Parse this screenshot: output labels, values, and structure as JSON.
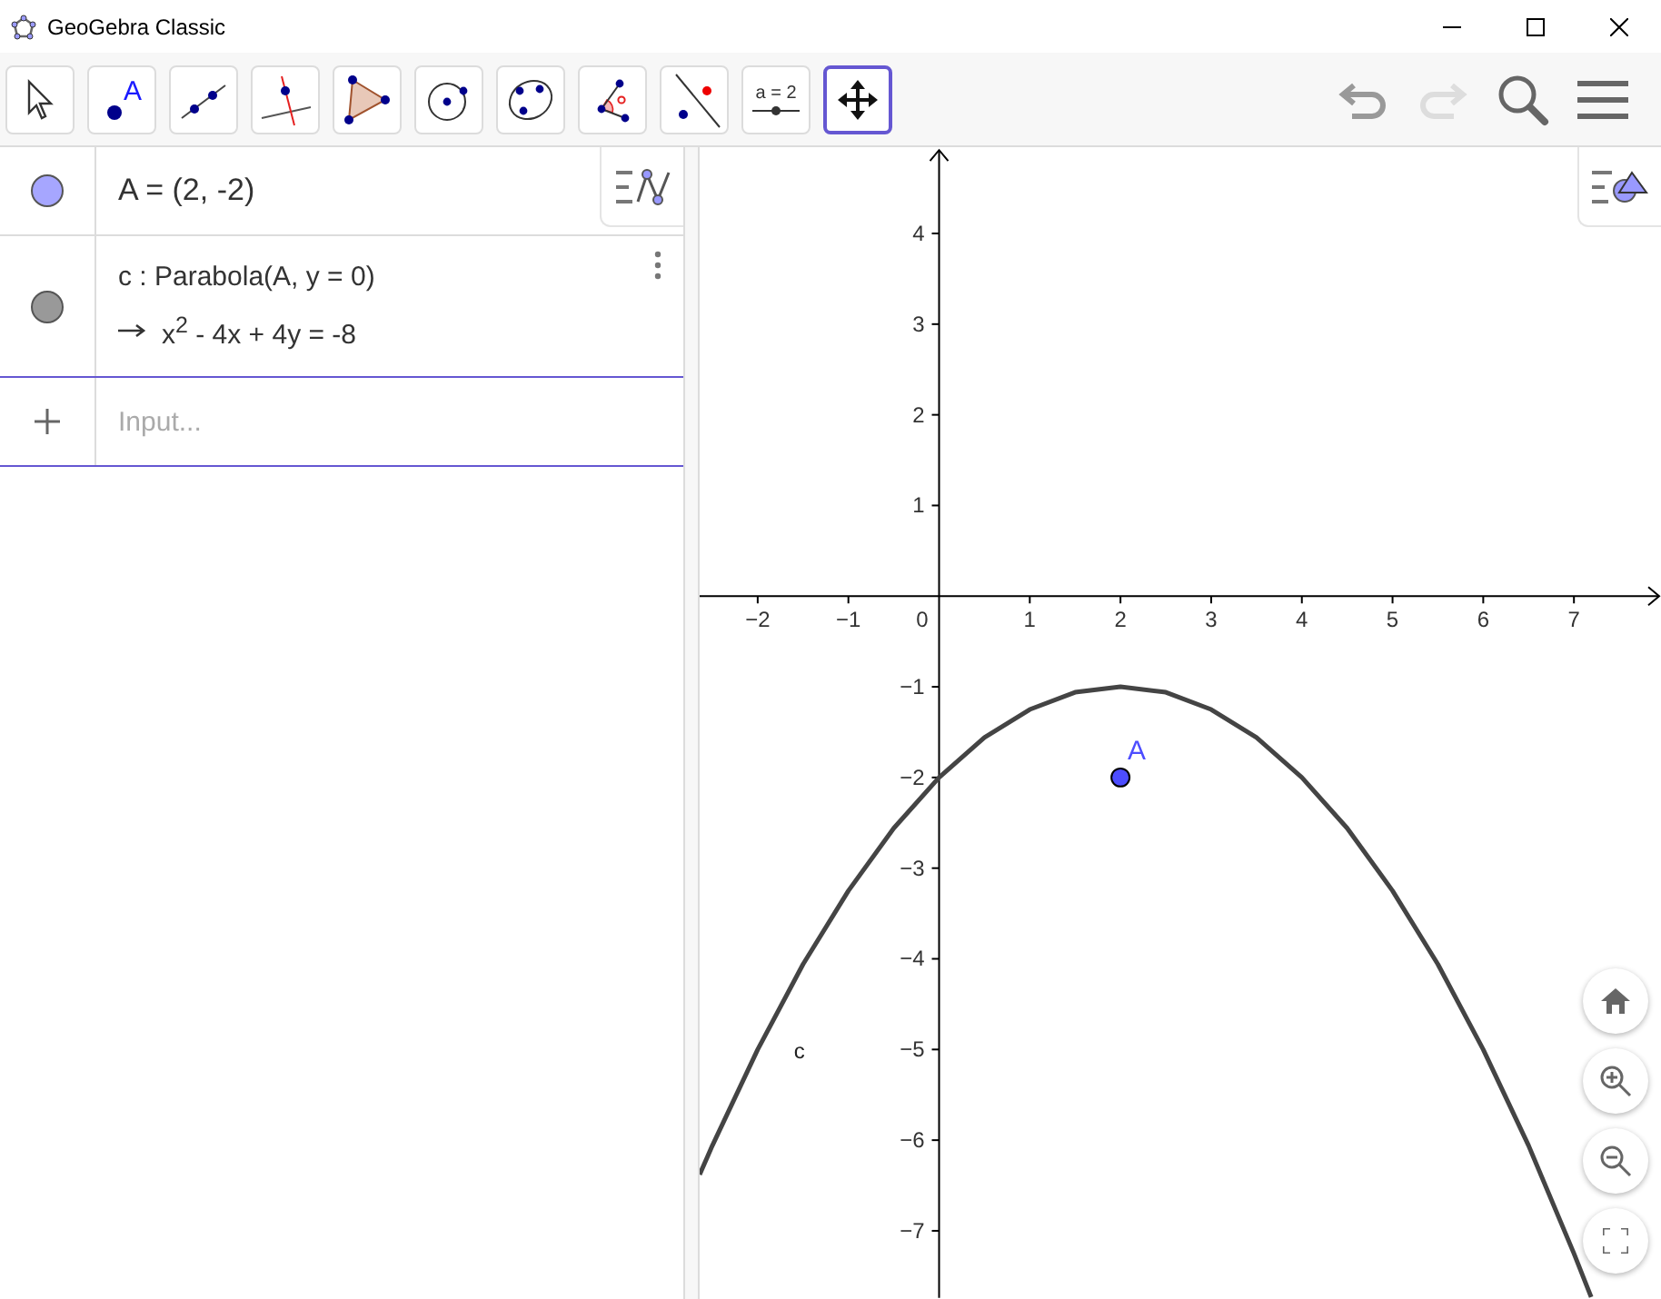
{
  "window": {
    "title": "GeoGebra Classic"
  },
  "toolbar": {
    "tools": [
      {
        "kind": "move",
        "selected": false
      },
      {
        "kind": "point",
        "selected": false,
        "label": "A"
      },
      {
        "kind": "line",
        "selected": false
      },
      {
        "kind": "perpendicular",
        "selected": false
      },
      {
        "kind": "polygon",
        "selected": false
      },
      {
        "kind": "circle",
        "selected": false
      },
      {
        "kind": "ellipse",
        "selected": false
      },
      {
        "kind": "angle",
        "selected": false
      },
      {
        "kind": "reflect",
        "selected": false
      },
      {
        "kind": "slider",
        "selected": false,
        "label": "a = 2"
      },
      {
        "kind": "pan",
        "selected": true
      }
    ],
    "undo": {
      "disabled": false
    },
    "redo": {
      "disabled": true
    }
  },
  "algebra": {
    "items": [
      {
        "kind": "point",
        "color": "#a6a6ff",
        "visible": true,
        "definition": "A = (2, -2)"
      },
      {
        "kind": "conic",
        "color": "#999999",
        "visible": true,
        "definition": "c : Parabola(A, y = 0)",
        "value": "x$^{2}$ - 4x + 4y = -8"
      }
    ],
    "input": {
      "placeholder": "Input..."
    }
  },
  "graphics": {
    "chart_data": {
      "type": "line",
      "x": [
        -2.64,
        -2.5,
        -2,
        -1.5,
        -1,
        -0.5,
        0,
        0.5,
        1,
        1.5,
        2,
        2.5,
        3,
        3.5,
        4,
        4.5,
        5,
        5.5,
        6,
        6.5,
        7,
        7.19
      ],
      "series": [
        {
          "name": "c",
          "color": "#444444",
          "values": [
            -6.38,
            -6.06,
            -5,
            -4.06,
            -3.25,
            -2.56,
            -2,
            -1.56,
            -1.25,
            -1.06,
            -1,
            -1.06,
            -1.25,
            -1.56,
            -2,
            -2.56,
            -3.25,
            -4.06,
            -5,
            -6.06,
            -7.25,
            -7.73
          ]
        }
      ],
      "xlim": [
        -2.64,
        7.96
      ],
      "ylim": [
        -7.74,
        4.94
      ],
      "xticks": [
        {
          "value": -2,
          "label": "−2"
        },
        {
          "value": -1,
          "label": "−1"
        },
        1,
        2,
        3,
        4,
        5,
        6,
        7
      ],
      "yticks": [
        4,
        3,
        2,
        1,
        {
          "value": -1,
          "label": "−1"
        },
        {
          "value": -2,
          "label": "−2"
        },
        {
          "value": -3,
          "label": "−3"
        },
        {
          "value": -4,
          "label": "−4"
        },
        {
          "value": -5,
          "label": "−5"
        },
        {
          "value": -6,
          "label": "−6"
        },
        {
          "value": -7,
          "label": "−7"
        }
      ],
      "annotations": [
        {
          "text": "A",
          "x": 2,
          "y": -2
        }
      ]
    },
    "origin_label": "0"
  }
}
